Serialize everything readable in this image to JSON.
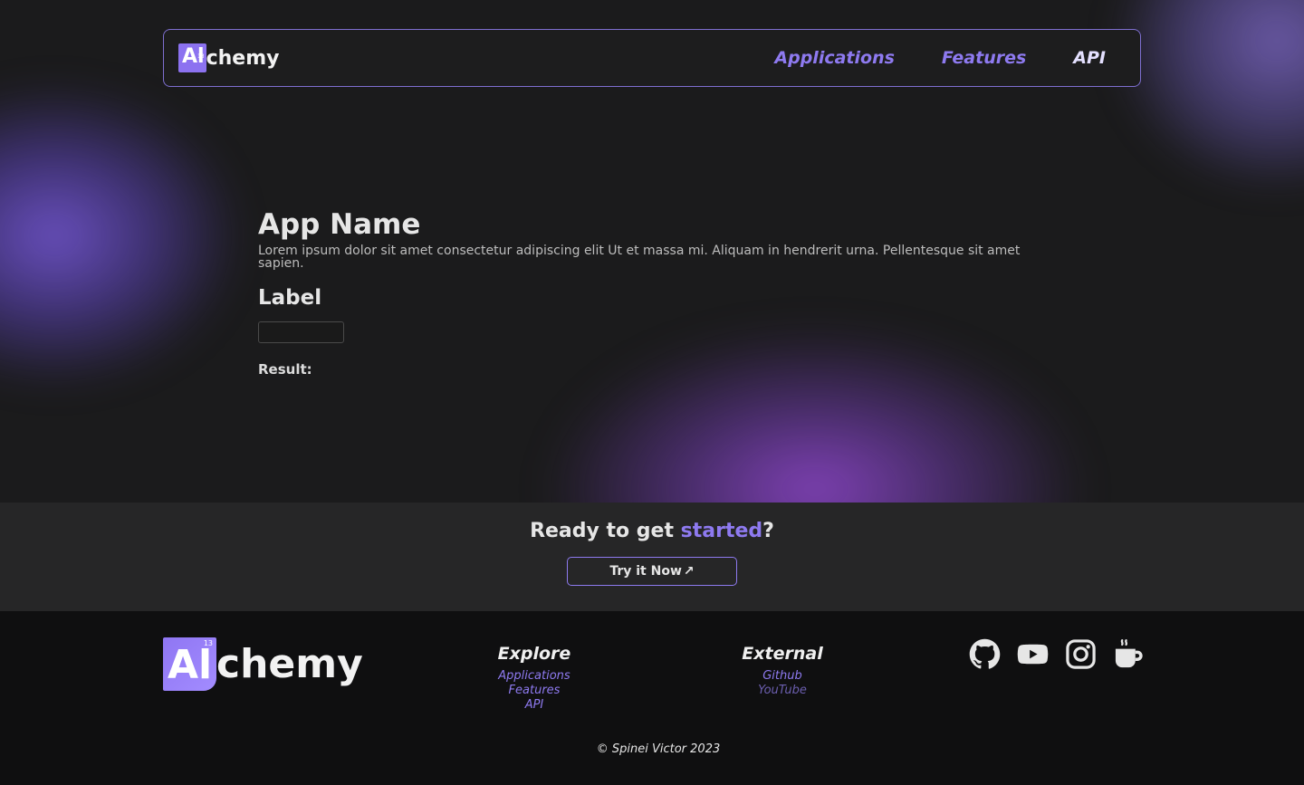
{
  "navbar": {
    "brand_badge": "Al",
    "brand_badge_sup": "13",
    "brand_rest": "chemy",
    "links": [
      {
        "label": "Applications"
      },
      {
        "label": "Features"
      },
      {
        "label": "API"
      }
    ]
  },
  "main": {
    "app_name": "App Name",
    "description": "Lorem ipsum dolor sit amet consectetur adipiscing elit Ut et massa mi. Aliquam in hendrerit urna. Pellentesque sit amet sapien.",
    "field_label": "Label",
    "input_value": "",
    "result_label": "Result:"
  },
  "cta": {
    "title_prefix": "Ready to get ",
    "title_accent": "started",
    "title_suffix": "?",
    "button_label": "Try it Now",
    "button_icon": "↗"
  },
  "footer": {
    "logo_badge": "Al",
    "logo_badge_sup": "13",
    "logo_rest": "chemy",
    "explore": {
      "title": "Explore",
      "links": [
        "Applications",
        "Features",
        "API"
      ]
    },
    "external": {
      "title": "External",
      "links": [
        "Github",
        "YouTube"
      ]
    },
    "social_icons": [
      "github-icon",
      "youtube-icon",
      "instagram-icon",
      "coffee-icon"
    ],
    "copyright": "© Spinei Victor 2023"
  },
  "colors": {
    "accent": "#8e7af0",
    "background": "#1b1b1c",
    "cta_background": "#262627",
    "footer_background": "#0f0f10"
  }
}
